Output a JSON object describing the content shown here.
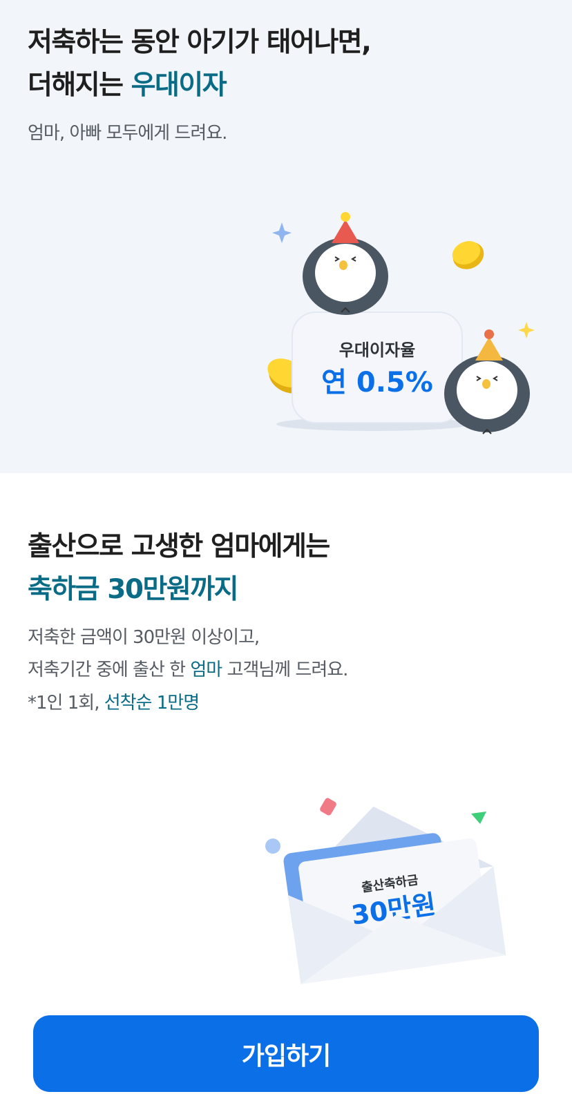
{
  "section1": {
    "title_line1": "저축하는 동안 아기가 태어나면,",
    "title_line2_prefix": "더해지는 ",
    "title_line2_highlight": "우대이자",
    "subtitle": "엄마, 아빠 모두에게 드려요.",
    "badge_label": "우대이자율",
    "badge_value": "연 0.5%"
  },
  "section2": {
    "title_line1": "출산으로 고생한 엄마에게는",
    "title_line2": "축하금 30만원까지",
    "desc_line1": "저축한 금액이 30만원 이상이고,",
    "desc_line2_prefix": "저축기간 중에 출산 한 ",
    "desc_line2_highlight": "엄마",
    "desc_line2_suffix": " 고객님께 드려요.",
    "desc_line3_prefix": "*1인 1회, ",
    "desc_line3_highlight": "선착순 1만명",
    "envelope_label": "출산축하금",
    "envelope_value": "30만원"
  },
  "cta": {
    "join_label": "가입하기"
  },
  "colors": {
    "accent": "#0a6b86",
    "primary": "#0b6fe8",
    "top_background": "#f2f5f9"
  },
  "icons": [
    "penguin-party-icon",
    "coin-icon",
    "sparkle-icon",
    "envelope-icon",
    "confetti-icon"
  ]
}
